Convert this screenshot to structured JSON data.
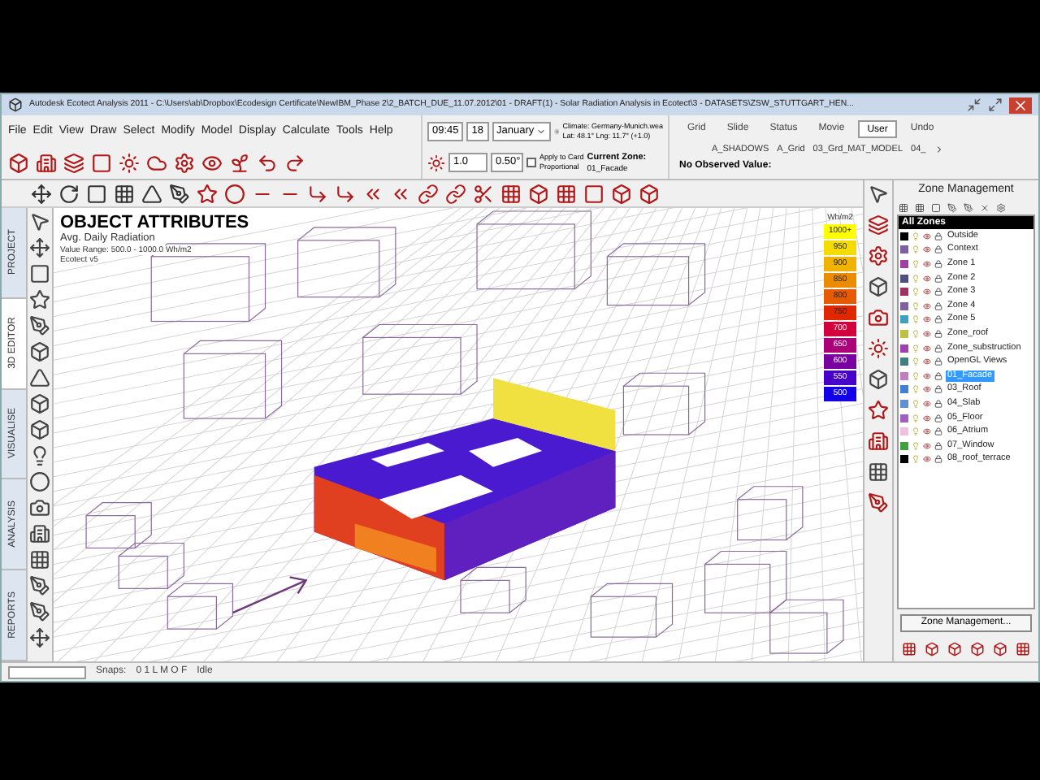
{
  "window": {
    "title": "Autodesk Ecotect Analysis 2011 - C:\\Users\\ab\\Dropbox\\Ecodesign Certificate\\NewIBM_Phase 2\\2_BATCH_DUE_11.07.2012\\01 - DRAFT(1) - Solar Radiation Analysis in Ecotect\\3 - DATASETS\\ZSW_STUTTGART_HEN..."
  },
  "menu": [
    "File",
    "Edit",
    "View",
    "Draw",
    "Select",
    "Modify",
    "Model",
    "Display",
    "Calculate",
    "Tools",
    "Help"
  ],
  "date_time": {
    "time": "09:45",
    "day": "18",
    "month": "January"
  },
  "climate": {
    "line1": "Climate: Germany-Munich.wea",
    "line2": "Lat: 48.1°  Lng: 11.7° (+1.0)"
  },
  "scale_fields": {
    "value1": "1.0",
    "value2": "0.50°"
  },
  "apply": {
    "line1": "Apply to Card",
    "line2": "Proportional",
    "checked": false
  },
  "current_zone": {
    "label": "Current Zone:",
    "value": "01_Facade"
  },
  "view_tabs": [
    {
      "label": "Grid",
      "selected": false
    },
    {
      "label": "Slide",
      "selected": false
    },
    {
      "label": "Status",
      "selected": false
    },
    {
      "label": "Movie",
      "selected": false
    },
    {
      "label": "User",
      "selected": true
    },
    {
      "label": "Undo",
      "selected": false
    }
  ],
  "saved_views": [
    "A_SHADOWS",
    "A_Grid",
    "03_Grd_MAT_MODEL",
    "04_"
  ],
  "observed": "No Observed Value:",
  "side_tabs": [
    {
      "label": "PROJECT",
      "selected": false
    },
    {
      "label": "3D EDITOR",
      "selected": true
    },
    {
      "label": "VISUALISE",
      "selected": false
    },
    {
      "label": "ANALYSIS",
      "selected": false
    },
    {
      "label": "REPORTS",
      "selected": false
    }
  ],
  "attributes": {
    "title": "OBJECT ATTRIBUTES",
    "subtitle": "Avg. Daily Radiation",
    "range": "Value Range: 500.0 - 1000.0 Wh/m2",
    "source": "Ecotect v5"
  },
  "legend": {
    "unit": "Wh/m2",
    "bands": [
      {
        "label": "1000+",
        "color": "#ffff00"
      },
      {
        "label": "950",
        "color": "#f5dc00"
      },
      {
        "label": "900",
        "color": "#f0b400"
      },
      {
        "label": "850",
        "color": "#eb8c00"
      },
      {
        "label": "800",
        "color": "#e65a00"
      },
      {
        "label": "750",
        "color": "#e02800"
      },
      {
        "label": "700",
        "color": "#d2003c"
      },
      {
        "label": "650",
        "color": "#aa0078"
      },
      {
        "label": "600",
        "color": "#7800a0"
      },
      {
        "label": "550",
        "color": "#4600c8"
      },
      {
        "label": "500",
        "color": "#1400e6"
      }
    ]
  },
  "zone_panel": {
    "title": "Zone Management",
    "header": "All Zones",
    "button": "Zone Management..."
  },
  "zones": [
    {
      "name": "Outside",
      "color": "#000000",
      "selected": false
    },
    {
      "name": "Context",
      "color": "#7f5f9f",
      "selected": false
    },
    {
      "name": "Zone 1",
      "color": "#a040a0",
      "selected": false
    },
    {
      "name": "Zone 2",
      "color": "#505080",
      "selected": false
    },
    {
      "name": "Zone 3",
      "color": "#a03060",
      "selected": false
    },
    {
      "name": "Zone 4",
      "color": "#8060a0",
      "selected": false
    },
    {
      "name": "Zone 5",
      "color": "#40a0c0",
      "selected": false
    },
    {
      "name": "Zone_roof",
      "color": "#c0c040",
      "selected": false
    },
    {
      "name": "Zone_substruction",
      "color": "#a040b0",
      "selected": false
    },
    {
      "name": "OpenGL Views",
      "color": "#408080",
      "selected": false
    },
    {
      "name": "01_Facade",
      "color": "#c080c0",
      "selected": true
    },
    {
      "name": "03_Roof",
      "color": "#4080d0",
      "selected": false
    },
    {
      "name": "04_Slab",
      "color": "#6090d0",
      "selected": false
    },
    {
      "name": "05_Floor",
      "color": "#a060c0",
      "selected": false
    },
    {
      "name": "06_Atrium",
      "color": "#f0c0e0",
      "selected": false
    },
    {
      "name": "07_Window",
      "color": "#40a040",
      "selected": false
    },
    {
      "name": "08_roof_terrace",
      "color": "#000000",
      "selected": false
    }
  ],
  "status_bar": {
    "snaps_label": "Snaps:",
    "snaps": "0 1 L M O F",
    "state": "Idle"
  }
}
